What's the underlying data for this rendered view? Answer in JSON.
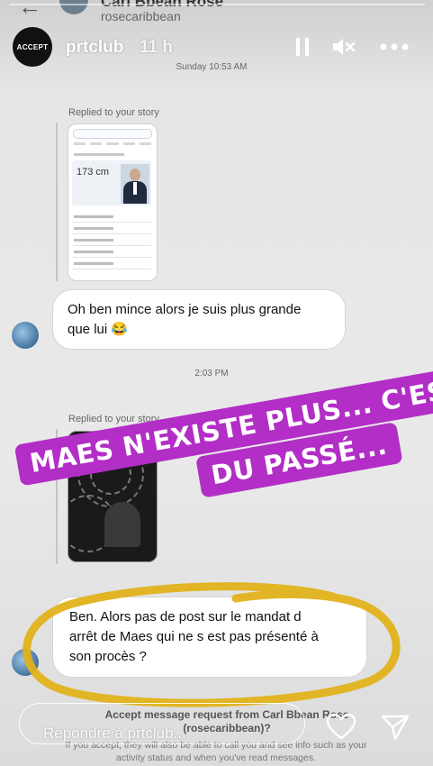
{
  "background_thread": {
    "contact_name": "Carl Bbean Rose",
    "contact_handle": "rosecaribbean"
  },
  "story": {
    "avatar_text": "ACCEPT",
    "username": "prtclub",
    "time_ago": "11 h"
  },
  "conversation": {
    "timestamp_1": "Sunday 10:53 AM",
    "replied_label_1": "Replied to your story",
    "card1_height_text": "173 cm",
    "message_1_line1": "Oh ben mince alors je suis plus grande",
    "message_1_line2": "que lui 😂",
    "timestamp_2": "2:03 PM",
    "replied_label_2": "Replied to your story",
    "message_2_line1": "Ben. Alors pas de post sur le mandat d",
    "message_2_line2": "arrêt de Maes  qui ne s est pas présenté à",
    "message_2_line3": "son procès ?"
  },
  "sticker": {
    "line1": "MAES N'EXISTE PLUS... C'EST",
    "line2": "DU PASSÉ...",
    "color": "#b22ec6"
  },
  "scribble_color": "#e0b21a",
  "request": {
    "title_line1": "Accept message request from Carl Bbean Rose",
    "title_line2": "(rosecaribbean)?",
    "subtitle_line1": "If you accept, they will also be able to call you and see info such as your",
    "subtitle_line2": "activity status and when you've read messages."
  },
  "reply": {
    "placeholder": "Répondre à prtclub..."
  }
}
